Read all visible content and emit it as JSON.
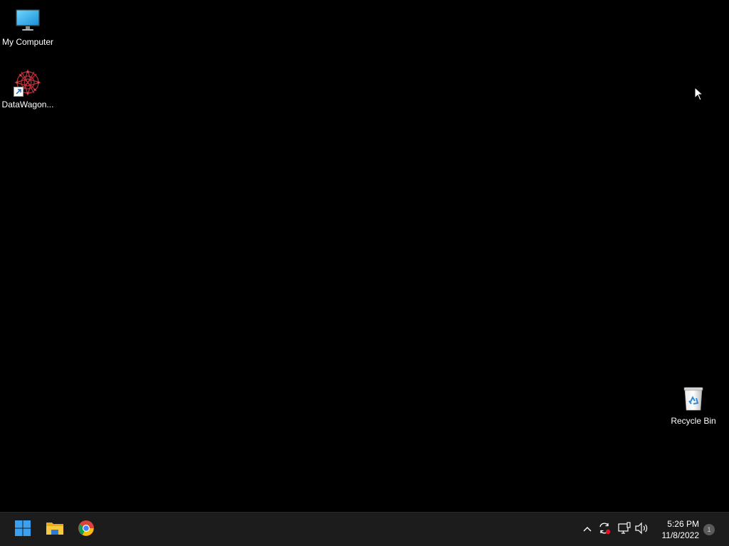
{
  "desktop": {
    "background": "#000000",
    "icons": [
      {
        "label": "My Computer",
        "icon": "monitor-icon"
      },
      {
        "label": "DataWagon...",
        "icon": "datawagon-app-icon"
      },
      {
        "label": "Recycle Bin",
        "icon": "recycle-bin-icon"
      }
    ]
  },
  "taskbar": {
    "background": "#1c1c1c",
    "pinned": [
      {
        "name": "Start",
        "icon": "windows-start-icon"
      },
      {
        "name": "File Explorer",
        "icon": "folder-icon"
      },
      {
        "name": "Google Chrome",
        "icon": "chrome-icon"
      }
    ],
    "tray": {
      "icons": [
        "chevron-up-icon",
        "sync-icon",
        "network-icon",
        "volume-icon"
      ],
      "time": "5:26 PM",
      "date": "11/8/2022",
      "notification_count": "1"
    }
  }
}
